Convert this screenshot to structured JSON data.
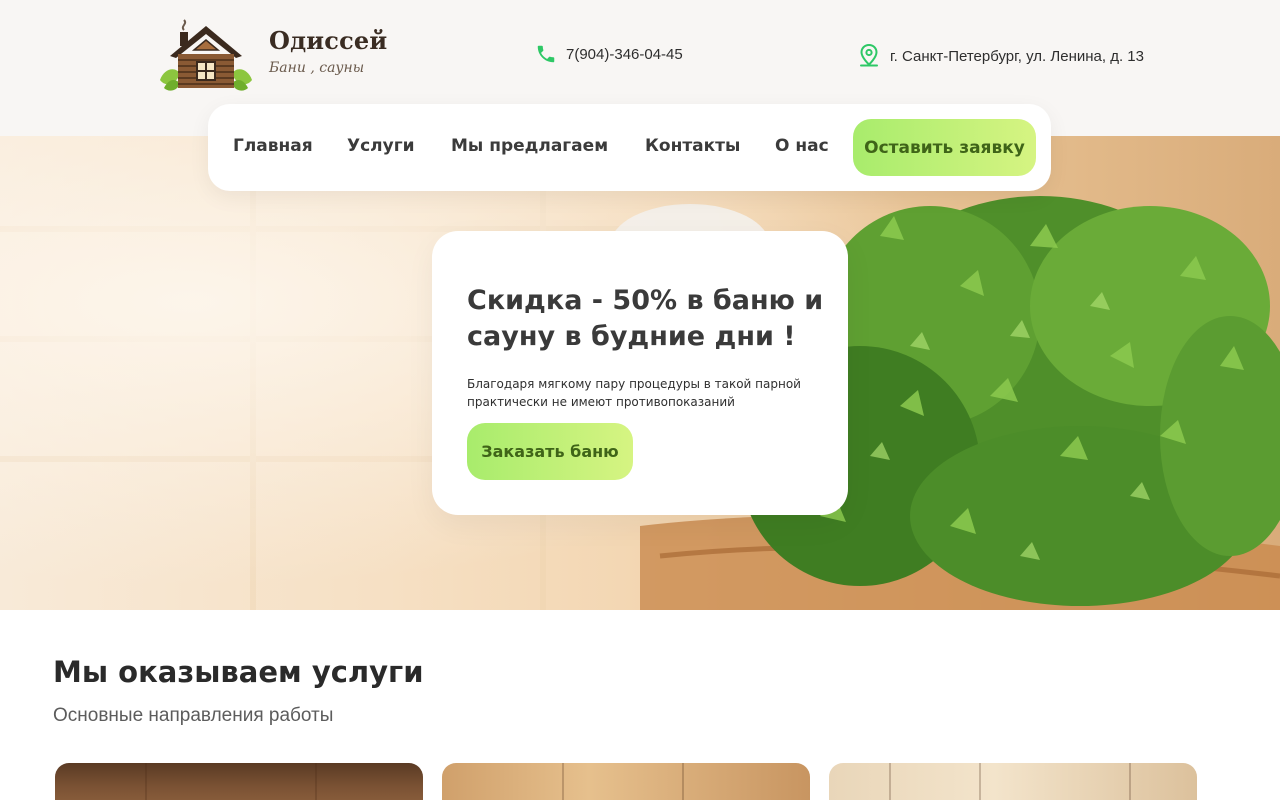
{
  "brand": {
    "name": "Одиссей",
    "tagline": "Бани , сауны",
    "logo_icon": "log-cabin-icon"
  },
  "contacts": {
    "phone": "7(904)-346-04-45",
    "phone_icon": "phone-icon",
    "address": "г. Санкт-Петербург, ул. Ленина, д. 13",
    "address_icon": "location-pin-icon"
  },
  "nav": {
    "items": [
      {
        "label": "Главная"
      },
      {
        "label": "Услуги"
      },
      {
        "label": "Мы предлагаем"
      },
      {
        "label": "Контакты"
      },
      {
        "label": "О нас"
      }
    ],
    "cta_label": "Оставить заявку"
  },
  "hero": {
    "title": "Скидка - 50% в баню и сауну в будние дни !",
    "text": "Благодаря мягкому пару процедуры в такой парной практически не имеют противопоказаний",
    "button_label": "Заказать баню"
  },
  "services": {
    "title": "Мы оказываем услуги",
    "subtitle": "Основные направления работы"
  },
  "colors": {
    "accent_start": "#a8ec6c",
    "accent_end": "#d6f482",
    "accent_text": "#3f6418",
    "icon_green": "#2ec866"
  }
}
